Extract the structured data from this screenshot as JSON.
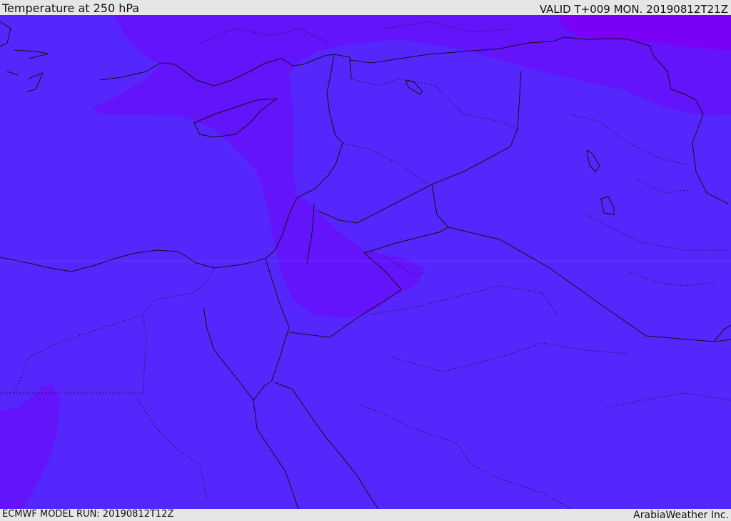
{
  "header": {
    "title": "Temperature at 250 hPa",
    "valid": "VALID T+009 MON. 20190812T21Z"
  },
  "footer": {
    "model_run": "ECMWF MODEL RUN: 20190812T12Z",
    "credit": "ArabiaWeather Inc."
  },
  "colors": {
    "base_fill": "#5627fc",
    "warm_fill": "#6414fb",
    "warmest_fill": "#7a00f7",
    "border_line": "#111111",
    "header_bg": "#e6e6e6"
  }
}
